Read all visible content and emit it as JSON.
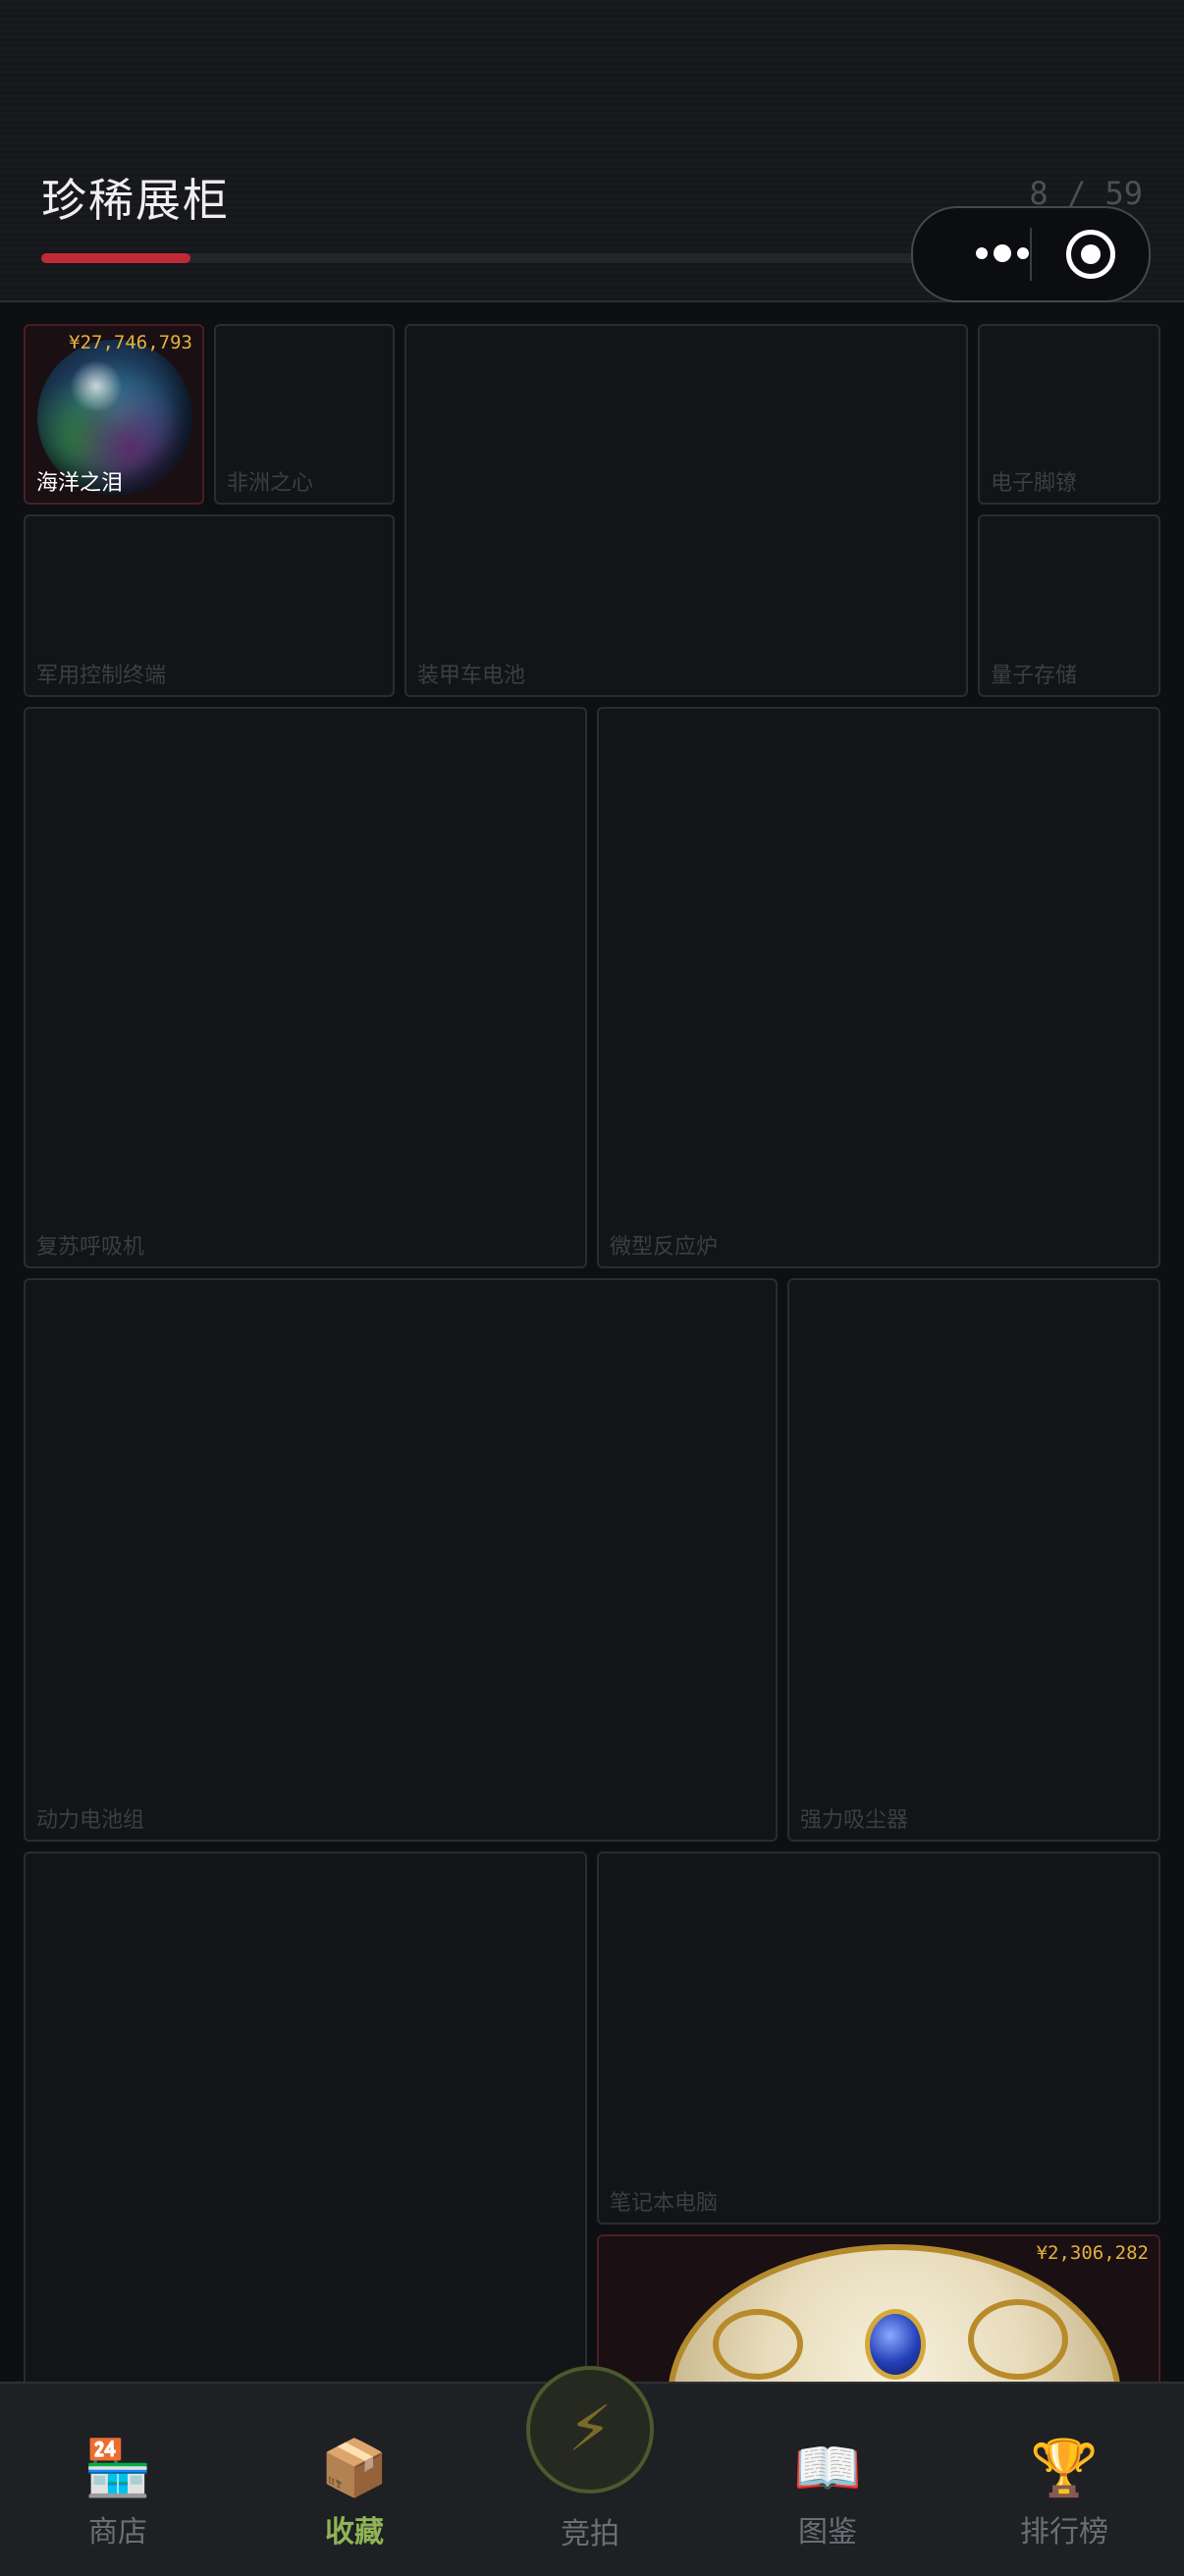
{
  "header": {
    "title": "珍稀展柜",
    "counter": "8 / 59",
    "progress": 0.136
  },
  "capsule": {
    "more_icon": "more-dots-icon",
    "close_icon": "target-circle-icon"
  },
  "cards": [
    {
      "id": "ocean-tear",
      "label": "海洋之泪",
      "price": "¥27,746,793",
      "owned": true
    },
    {
      "id": "africa-heart",
      "label": "非洲之心",
      "owned": false
    },
    {
      "id": "apc-battery",
      "label": "装甲车电池",
      "owned": false
    },
    {
      "id": "e-anklet",
      "label": "电子脚镣",
      "owned": false
    },
    {
      "id": "mil-terminal",
      "label": "军用控制终端",
      "owned": false
    },
    {
      "id": "quantum-storage",
      "label": "量子存储",
      "owned": false
    },
    {
      "id": "revive-respirator",
      "label": "复苏呼吸机",
      "owned": false
    },
    {
      "id": "micro-reactor",
      "label": "微型反应炉",
      "owned": false
    },
    {
      "id": "power-pack",
      "label": "动力电池组",
      "owned": false
    },
    {
      "id": "vacuum",
      "label": "强力吸尘器",
      "owned": false
    },
    {
      "id": "unknown-tall",
      "label": "",
      "owned": false
    },
    {
      "id": "laptop",
      "label": "笔记本电脑",
      "owned": false
    },
    {
      "id": "egg",
      "label": "",
      "price": "¥2,306,282",
      "owned": true
    }
  ],
  "nav": {
    "shop": "商店",
    "collection": "收藏",
    "auction": "竞拍",
    "codex": "图鉴",
    "ranking": "排行榜"
  }
}
